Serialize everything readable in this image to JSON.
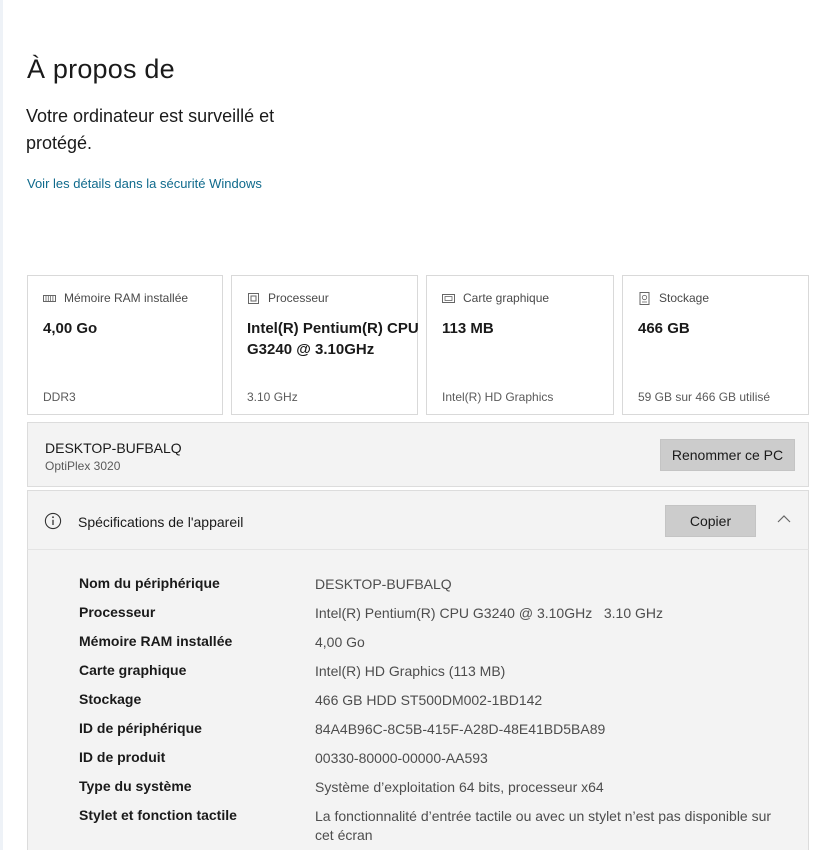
{
  "page": {
    "title": "À propos de",
    "protection_text": "Votre ordinateur est surveillé et protégé.",
    "security_link": "Voir les détails dans la sécurité Windows"
  },
  "cards": [
    {
      "label": "Mémoire RAM installée",
      "value": "4,00 Go",
      "sub": "DDR3",
      "icon": "memory-icon"
    },
    {
      "label": "Processeur",
      "value": "Intel(R) Pentium(R) CPU G3240 @ 3.10GHz",
      "sub": "3.10 GHz",
      "icon": "processor-icon"
    },
    {
      "label": "Carte graphique",
      "value": "113 MB",
      "sub": "Intel(R) HD Graphics",
      "icon": "graphics-card-icon"
    },
    {
      "label": "Stockage",
      "value": "466 GB",
      "sub": "59 GB sur 466 GB utilisé",
      "icon": "storage-icon"
    }
  ],
  "pc": {
    "name": "DESKTOP-BUFBALQ",
    "model": "OptiPlex 3020",
    "rename_label": "Renommer ce PC"
  },
  "specs": {
    "title": "Spécifications de l'appareil",
    "copy_label": "Copier",
    "rows": [
      {
        "label": "Nom du périphérique",
        "value": "DESKTOP-BUFBALQ"
      },
      {
        "label": "Processeur",
        "value": "Intel(R) Pentium(R) CPU G3240 @ 3.10GHz   3.10 GHz"
      },
      {
        "label": "Mémoire RAM installée",
        "value": "4,00 Go"
      },
      {
        "label": "Carte graphique",
        "value": "Intel(R) HD Graphics (113 MB)"
      },
      {
        "label": "Stockage",
        "value": "466 GB HDD ST500DM002-1BD142"
      },
      {
        "label": "ID de périphérique",
        "value": "84A4B96C-8C5B-415F-A28D-48E41BD5BA89"
      },
      {
        "label": "ID de produit",
        "value": "00330-80000-00000-AA593"
      },
      {
        "label": "Type du système",
        "value": "Système d’exploitation 64 bits, processeur x64"
      },
      {
        "label": "Stylet et fonction tactile",
        "value": "La fonctionnalité d’entrée tactile ou avec un stylet n’est pas disponible sur cet écran"
      }
    ]
  }
}
